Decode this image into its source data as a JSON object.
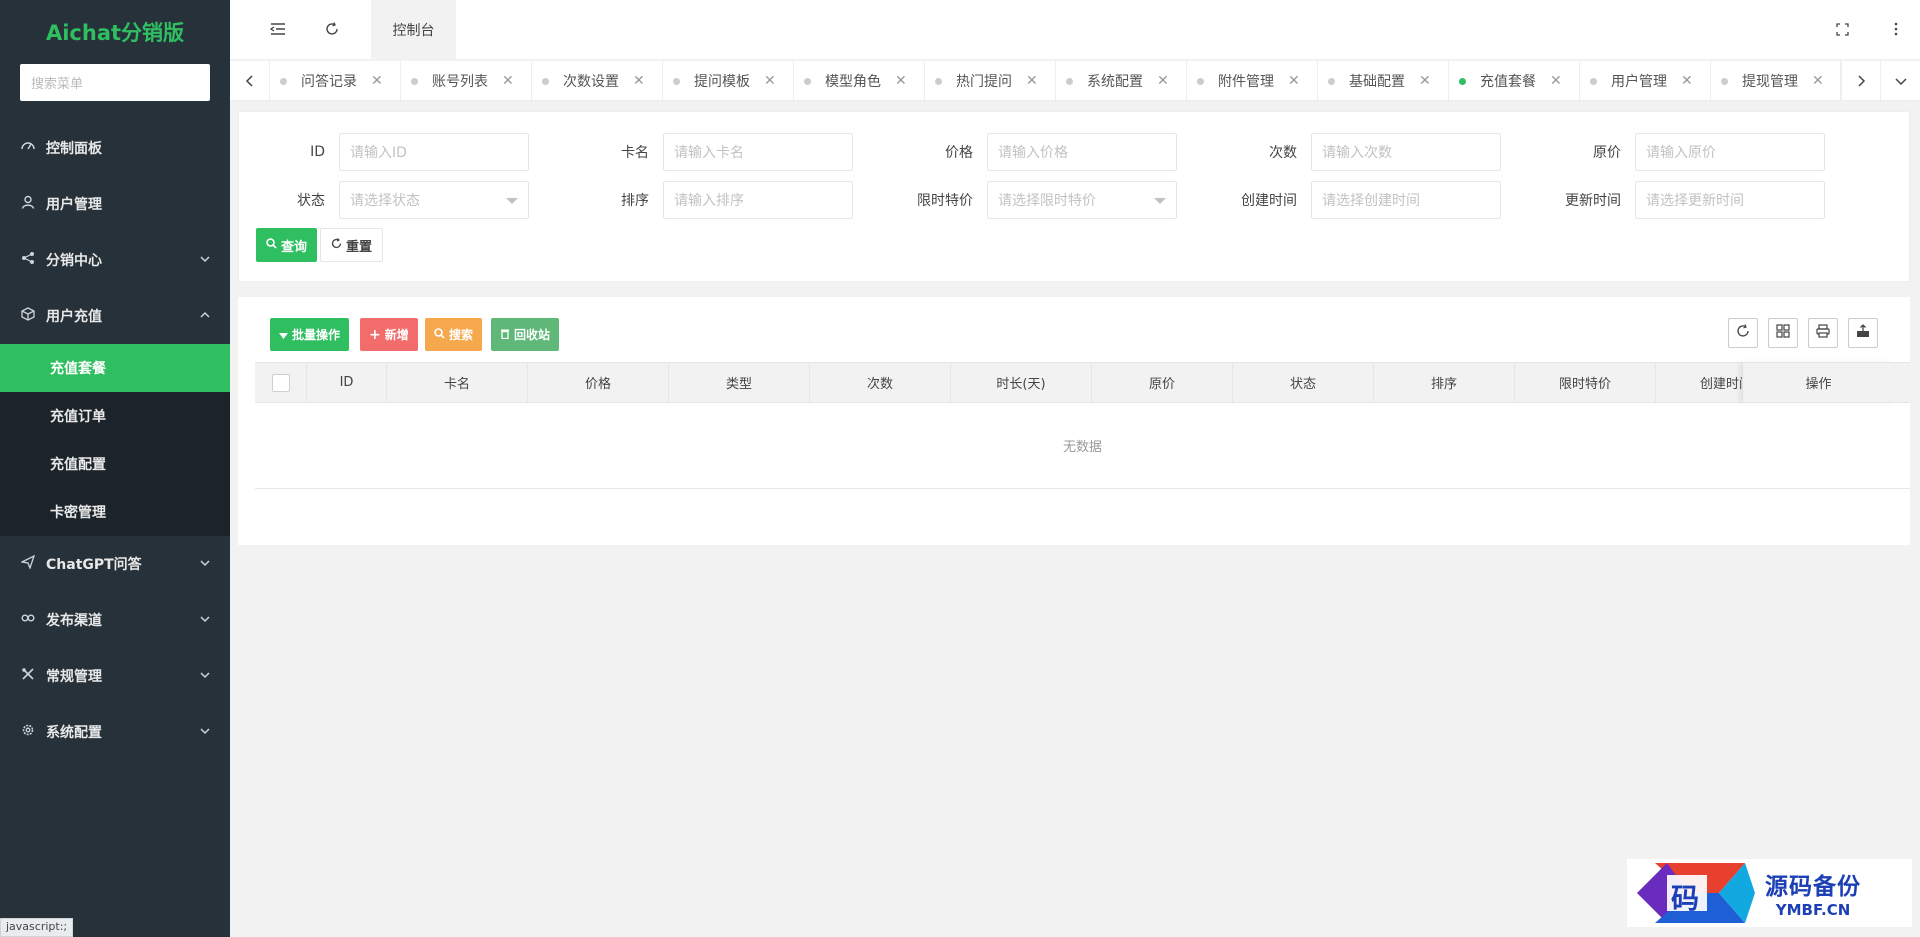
{
  "sidebar": {
    "logo": "Aichat分销版",
    "search_placeholder": "搜索菜单",
    "items": [
      {
        "label": "控制面板",
        "icon": "dashboard-icon"
      },
      {
        "label": "用户管理",
        "icon": "user-icon"
      },
      {
        "label": "分销中心",
        "icon": "share-icon"
      },
      {
        "label": "用户充值",
        "icon": "cube-icon"
      }
    ],
    "submenu": [
      {
        "label": "充值套餐",
        "active": true
      },
      {
        "label": "充值订单"
      },
      {
        "label": "充值配置"
      },
      {
        "label": "卡密管理"
      }
    ],
    "items_after": [
      {
        "label": "ChatGPT问答",
        "icon": "send-icon"
      },
      {
        "label": "发布渠道",
        "icon": "link-icon"
      },
      {
        "label": "常规管理",
        "icon": "tools-icon"
      },
      {
        "label": "系统配置",
        "icon": "gear-icon"
      }
    ],
    "status_tip": "javascript:;"
  },
  "topbar": {
    "console_tab": "控制台"
  },
  "tabs": [
    {
      "label": "问答记录"
    },
    {
      "label": "账号列表"
    },
    {
      "label": "次数设置"
    },
    {
      "label": "提问模板"
    },
    {
      "label": "模型角色"
    },
    {
      "label": "热门提问"
    },
    {
      "label": "系统配置"
    },
    {
      "label": "附件管理"
    },
    {
      "label": "基础配置"
    },
    {
      "label": "充值套餐",
      "active": true
    },
    {
      "label": "用户管理"
    },
    {
      "label": "提现管理"
    }
  ],
  "search_form": {
    "fields": [
      {
        "label": "ID",
        "placeholder": "请输入ID"
      },
      {
        "label": "卡名",
        "placeholder": "请输入卡名"
      },
      {
        "label": "价格",
        "placeholder": "请输入价格"
      },
      {
        "label": "次数",
        "placeholder": "请输入次数"
      },
      {
        "label": "原价",
        "placeholder": "请输入原价"
      },
      {
        "label": "状态",
        "placeholder": "请选择状态",
        "select": true
      },
      {
        "label": "排序",
        "placeholder": "请输入排序"
      },
      {
        "label": "限时特价",
        "placeholder": "请选择限时特价",
        "select": true
      },
      {
        "label": "创建时间",
        "placeholder": "请选择创建时间"
      },
      {
        "label": "更新时间",
        "placeholder": "请选择更新时间"
      }
    ],
    "query_label": "查询",
    "reset_label": "重置"
  },
  "toolbar": {
    "batch_label": "批量操作",
    "add_label": "新增",
    "search_label": "搜索",
    "recycle_label": "回收站",
    "colors": {
      "batch": "#2fbf61",
      "add": "#f26c6c",
      "search": "#f5a94c",
      "recycle": "#5fb878"
    }
  },
  "table": {
    "columns": [
      "ID",
      "卡名",
      "价格",
      "类型",
      "次数",
      "时长(天)",
      "原价",
      "状态",
      "排序",
      "限时特价",
      "创建时间"
    ],
    "op_column": "操作",
    "empty_text": "无数据"
  },
  "watermark": {
    "logo_char": "码",
    "cn": "源码备份",
    "en": "YMBF.CN"
  },
  "colors": {
    "accent": "#2fbf61",
    "sidebar_bg": "#263139",
    "sidebar_sub_bg": "#1b242b"
  }
}
